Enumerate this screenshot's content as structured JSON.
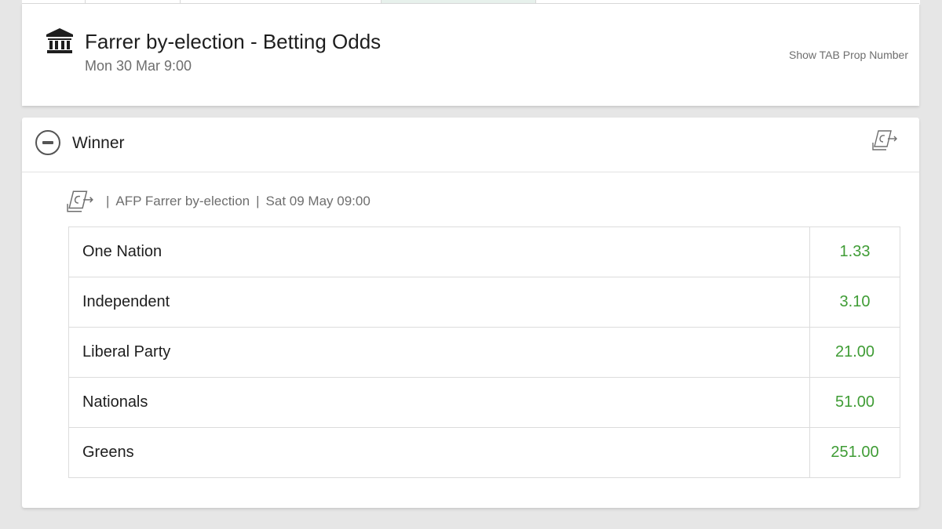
{
  "colors": {
    "price_green": "#3f9c35",
    "text_dark": "#1e1e1e",
    "text_muted": "#6e6e6e",
    "page_bg": "#e6e6e6"
  },
  "header": {
    "icon": "bank-building-icon",
    "title": "Farrer by-election - Betting Odds",
    "date": "Mon 30 Mar 9:00",
    "show_tab_prop_label": "Show TAB Prop Number"
  },
  "market": {
    "title": "Winner",
    "collapse_icon": "minus-circle-icon",
    "cashout_icon": "cash-out-icon",
    "meta": {
      "name": "AFP Farrer by-election",
      "date": "Sat 09 May 09:00"
    },
    "runners": [
      {
        "name": "One Nation",
        "price": "1.33"
      },
      {
        "name": "Independent",
        "price": "3.10"
      },
      {
        "name": "Liberal Party",
        "price": "21.00"
      },
      {
        "name": "Nationals",
        "price": "51.00"
      },
      {
        "name": "Greens",
        "price": "251.00"
      }
    ]
  }
}
